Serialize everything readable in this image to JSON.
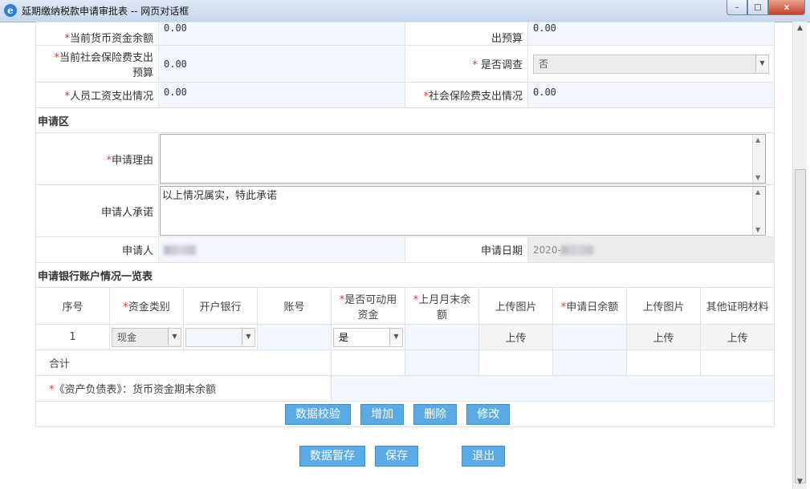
{
  "window": {
    "title": "延期缴纳税款申请审批表 -- 网页对话框",
    "icon": "ie-icon",
    "minimize": "–",
    "maximize": "□",
    "close": "x"
  },
  "top_fields": {
    "row1": {
      "label_left": "当前货币资金余额",
      "value_left": "0.00",
      "label_right_partial": "出预算",
      "value_right": "0.00"
    },
    "row2": {
      "label_left_1": "当前社会保险费支出",
      "label_left_2": "预算",
      "value_left": "0.00",
      "label_right": "是否调查",
      "value_right": "否"
    },
    "row3": {
      "label_left": "人员工资支出情况",
      "value_left": "0.00",
      "label_right": "社会保险费支出情况",
      "value_right": "0.00"
    }
  },
  "apply_section": {
    "title": "申请区",
    "reason_label": "申请理由",
    "reason_value": "",
    "promise_label": "申请人承诺",
    "promise_value": "以上情况属实，特此承诺",
    "applicant_label": "申请人",
    "date_label": "申请日期",
    "date_value": "2020-"
  },
  "bank_section": {
    "title": "申请银行账户情况一览表",
    "headers": [
      "序号",
      "资金类别",
      "开户银行",
      "账号",
      "是否可动用资金",
      "上月月末余额",
      "上传图片",
      "申请日余额",
      "上传图片",
      "其他证明材料"
    ],
    "row1": {
      "index": "1",
      "fund_type": "现金",
      "usable": "是",
      "upload1": "上传",
      "upload2": "上传",
      "upload3": "上传"
    },
    "total_label": "合计",
    "balance_label": "《资产负债表》：货币资金期末余额"
  },
  "table_buttons": {
    "validate": "数据校验",
    "add": "增加",
    "delete": "删除",
    "modify": "修改"
  },
  "footer_buttons": {
    "temp_save": "数据暂存",
    "save": "保存",
    "exit": "退出"
  },
  "colors": {
    "button": "#5aaae6",
    "required": "#e33333",
    "value_bg": "#f2f7fd"
  }
}
